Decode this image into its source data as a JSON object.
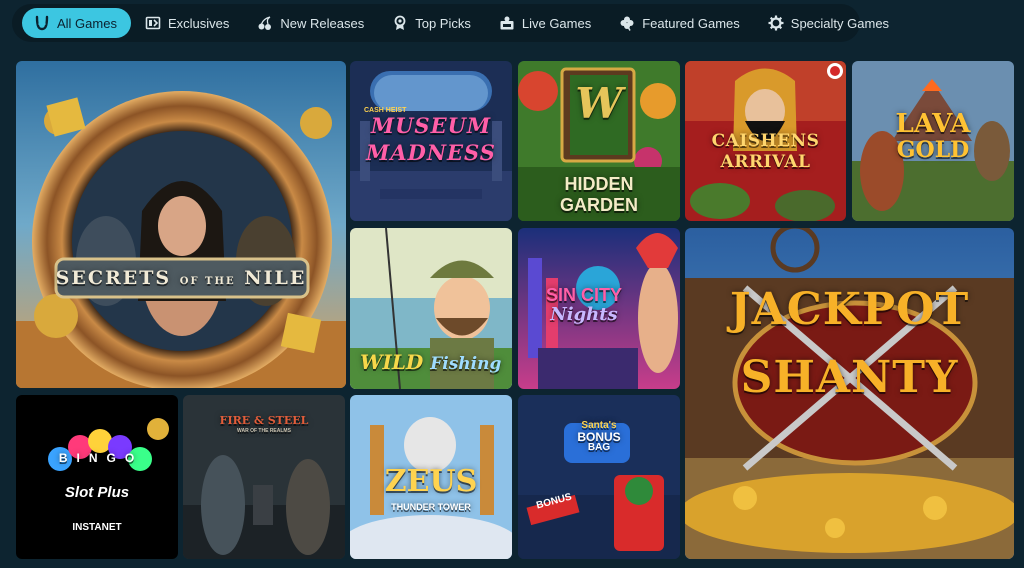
{
  "tabs": [
    {
      "label": "All Games",
      "icon": "horseshoe-icon",
      "active": true
    },
    {
      "label": "Exclusives",
      "icon": "exclusive-tag-icon",
      "active": false
    },
    {
      "label": "New Releases",
      "icon": "cherries-icon",
      "active": false
    },
    {
      "label": "Top Picks",
      "icon": "medal-icon",
      "active": false
    },
    {
      "label": "Live Games",
      "icon": "live-dealer-icon",
      "active": false
    },
    {
      "label": "Featured Games",
      "icon": "clover-icon",
      "active": false
    },
    {
      "label": "Specialty Games",
      "icon": "gear-icon",
      "active": false
    }
  ],
  "colors": {
    "page_bg": "#0d2430",
    "tabbar_bg": "#0a1c25",
    "active_tab": "#3cc6e1"
  },
  "games": {
    "secrets_nile": {
      "title": "SECRETS",
      "of": "OF THE",
      "sub": "NILE"
    },
    "museum": {
      "kicker": "CASH HEIST",
      "line1": "MUSEUM",
      "line2": "MADNESS"
    },
    "hidden_garden": {
      "line1": "HIDDEN",
      "line2": "GARDEN",
      "emblem": "W"
    },
    "caishens": {
      "line1": "CAISHENS",
      "line2": "ARRIVAL"
    },
    "lava_gold": {
      "line1": "LAVA",
      "line2": "GOLD"
    },
    "wild_fishing": {
      "line1": "WILD",
      "line2": "Fishing"
    },
    "sin_city": {
      "line1": "SIN CITY",
      "line2": "Nights"
    },
    "jackpot": {
      "line1": "JACKPOT",
      "line2": "SHANTY"
    },
    "bingo": {
      "title": "BINGO",
      "sub": "Slot Plus",
      "brand": "INSTANET"
    },
    "fire_steel": {
      "title": "FIRE & STEEL",
      "sub": "WAR OF THE REALMS"
    },
    "zeus": {
      "line1": "ZEUS",
      "line2": "THUNDER TOWER"
    },
    "santa": {
      "line1": "Santa's",
      "line2": "BONUS",
      "line3": "BAG",
      "ribbon": "BONUS"
    }
  }
}
